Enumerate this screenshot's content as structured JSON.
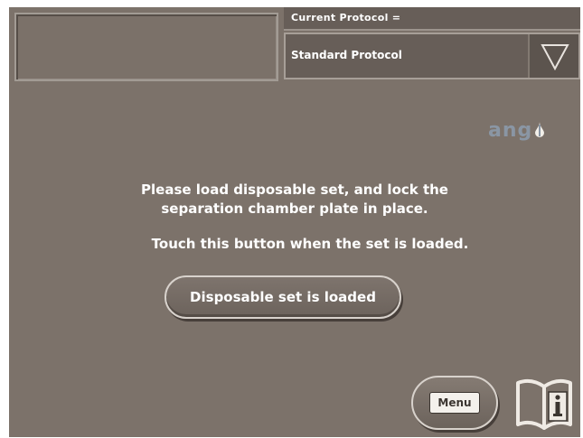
{
  "header": {
    "protocol_label": "Current Protocol =",
    "protocol_value": "Standard Protocol"
  },
  "logo": {
    "text": "ang"
  },
  "instructions": {
    "line1": "Please load disposable set, and lock the",
    "line2": "separation chamber plate in place.",
    "line3": "Touch this button when the set is loaded."
  },
  "buttons": {
    "loaded_label": "Disposable set is loaded",
    "menu_label": "Menu"
  },
  "icons": {
    "dropdown": "triangle-down-icon",
    "help": "book-info-icon"
  },
  "colors": {
    "screen_bg": "#7c726a",
    "logo": "#8a96a4",
    "text": "#ffffff"
  }
}
